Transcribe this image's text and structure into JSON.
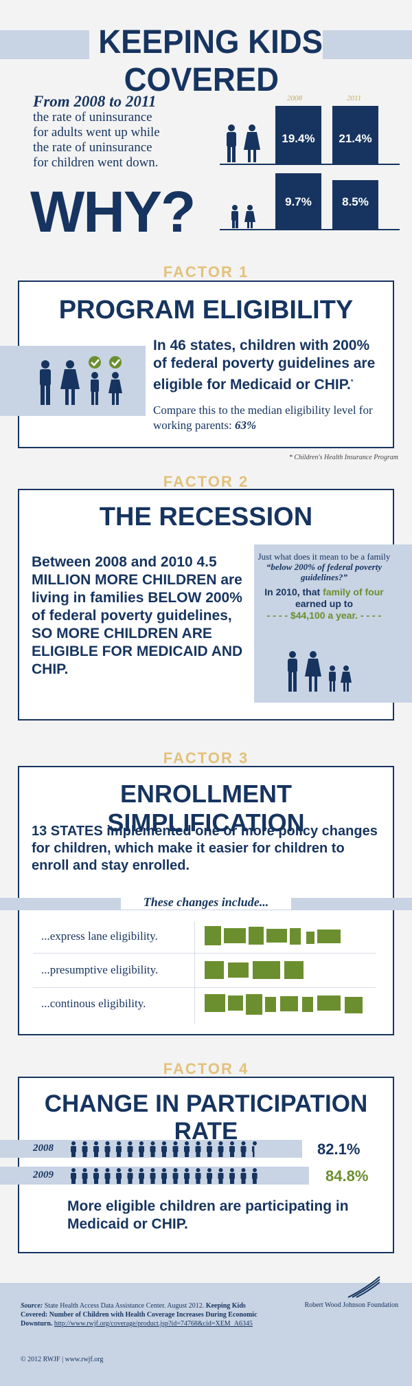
{
  "header": {
    "title": "KEEPING KIDS COVERED"
  },
  "intro": {
    "lead": "From 2008 to 2011",
    "text": [
      "the rate of uninsurance",
      "for adults went up while",
      "the rate of uninsurance",
      "for children went down."
    ],
    "why": "WHY?"
  },
  "uninsurance_chart": {
    "year_labels": [
      "2008",
      "2011"
    ],
    "adults": {
      "label_icon": "adults-icon",
      "values": [
        "19.4%",
        "21.4%"
      ]
    },
    "children": {
      "label_icon": "children-icon",
      "values": [
        "9.7%",
        "8.5%"
      ]
    }
  },
  "factor1": {
    "label": "FACTOR 1",
    "title": "PROGRAM ELIGIBILITY",
    "main": "In 46 states, children with 200% of federal poverty guidelines are eligible for Medicaid or CHIP.",
    "asterisk": "*",
    "compare": "Compare this to the median eligibility level for working parents:",
    "compare_value": "63%",
    "footnote": "* Children's Health Insurance Program"
  },
  "factor2": {
    "label": "FACTOR 2",
    "title": "THE RECESSION",
    "body": "Between 2008 and 2010 4.5 MILLION MORE CHILDREN are living in families BELOW 200% of federal poverty guidelines, SO MORE CHILDREN ARE ELIGIBLE FOR MEDICAID AND CHIP.",
    "side_q1": "Just what does it mean to be a family",
    "side_q2": "“below 200% of federal poverty guidelines?”",
    "side_a1": "In 2010, that ",
    "side_a_green": "family of four",
    "side_a2": " earned up to",
    "side_amount": "$44,100 a year."
  },
  "factor3": {
    "label": "FACTOR 3",
    "title": "ENROLLMENT SIMPLIFICATION",
    "body": "13 STATES implemented one or more policy changes for children, which make it easier for children to enroll and stay enrolled.",
    "changes_label": "These changes include...",
    "items": [
      "...express lane eligibility.",
      "...presumptive eligibility.",
      "...continous eligibility."
    ]
  },
  "factor4": {
    "label": "FACTOR 4",
    "title": "CHANGE IN PARTICIPATION RATE",
    "rows": [
      {
        "year": "2008",
        "value": "82.1%",
        "fraction": 0.821
      },
      {
        "year": "2009",
        "value": "84.8%",
        "fraction": 0.848
      }
    ],
    "conclusion": "More eligible children are participating in Medicaid or CHIP."
  },
  "footer": {
    "source_label": "Source:",
    "source_text": " State Health Access Data Assistance Center. August 2012.",
    "source_bold": " Keeping Kids Covered: Number of Children with Health Coverage Increases During Economic Downturn.",
    "source_link": "http://www.rwjf.org/coverage/product.jsp?id=74768&cid=XEM_A6345",
    "copyright": "© 2012 RWJF | www.rwjf.org",
    "logo_text": "Robert Wood Johnson Foundation"
  },
  "colors": {
    "navy": "#16345f",
    "light_blue": "#c8d3e4",
    "green": "#6b8f2e",
    "gold": "#e3c17c"
  }
}
